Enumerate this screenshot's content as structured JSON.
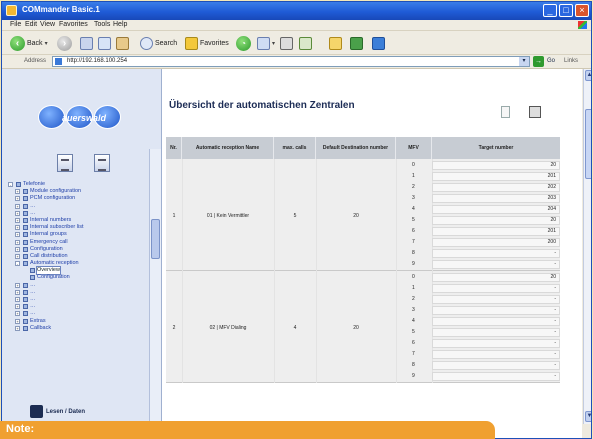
{
  "window": {
    "title": "COMmander Basic.1"
  },
  "menu": [
    "File",
    "Edit",
    "View",
    "Favorites",
    "Tools",
    "Help"
  ],
  "toolbar": {
    "back_label": "Back",
    "search_label": "Search",
    "favorites_label": "Favorites"
  },
  "address": {
    "label": "Address",
    "url": "http://192.168.100.254",
    "go_label": "Go",
    "links_label": "Links"
  },
  "logo_text": "auerswald",
  "tree": [
    {
      "label": "Telefonie",
      "level": 0,
      "expander": "-",
      "top": true
    },
    {
      "label": "Module configuration",
      "level": 1,
      "expander": "+"
    },
    {
      "label": "PCM configuration",
      "level": 1,
      "expander": "+"
    },
    {
      "label": "…",
      "level": 1,
      "expander": "+"
    },
    {
      "label": "…",
      "level": 1,
      "expander": "+"
    },
    {
      "label": "Internal numbers",
      "level": 1,
      "expander": "+"
    },
    {
      "label": "Internal subscriber list",
      "level": 1,
      "expander": "+"
    },
    {
      "label": "Internal groups",
      "level": 1,
      "expander": "+"
    },
    {
      "label": "Emergency call",
      "level": 1,
      "expander": "+"
    },
    {
      "label": "Configuration",
      "level": 1,
      "expander": "+"
    },
    {
      "label": "Call distribution",
      "level": 1,
      "expander": "+"
    },
    {
      "label": "Automatic reception",
      "level": 1,
      "expander": "-"
    },
    {
      "label": "Overview",
      "level": 2,
      "expander": "",
      "selected": true
    },
    {
      "label": "Configuration",
      "level": 2,
      "expander": ""
    },
    {
      "label": "…",
      "level": 1,
      "expander": "+"
    },
    {
      "label": "…",
      "level": 1,
      "expander": "+"
    },
    {
      "label": "…",
      "level": 1,
      "expander": "+"
    },
    {
      "label": "…",
      "level": 1,
      "expander": "+"
    },
    {
      "label": "…",
      "level": 1,
      "expander": "+"
    },
    {
      "label": "Extras",
      "level": 1,
      "expander": "+"
    },
    {
      "label": "Callback",
      "level": 1,
      "expander": "+"
    }
  ],
  "footer_brand": "Lesen / Daten",
  "page": {
    "title": "Übersicht der automatischen Zentralen"
  },
  "table": {
    "headers": [
      "Nr.",
      "Automatic reception Name",
      "max. calls",
      "Default Destination number",
      "MFV",
      "Target number"
    ],
    "groups": [
      {
        "nr": "1",
        "name": "01 | Kein Vermittler",
        "max_calls": "5",
        "default_dest": "20",
        "subrows": [
          {
            "mfv": "0",
            "target": "20"
          },
          {
            "mfv": "1",
            "target": "201"
          },
          {
            "mfv": "2",
            "target": "202"
          },
          {
            "mfv": "3",
            "target": "203"
          },
          {
            "mfv": "4",
            "target": "204"
          },
          {
            "mfv": "5",
            "target": "20"
          },
          {
            "mfv": "6",
            "target": "201"
          },
          {
            "mfv": "7",
            "target": "200"
          },
          {
            "mfv": "8",
            "target": "-"
          },
          {
            "mfv": "9",
            "target": "-"
          }
        ]
      },
      {
        "nr": "2",
        "name": "02 | MFV Dialing",
        "max_calls": "4",
        "default_dest": "20",
        "subrows": [
          {
            "mfv": "0",
            "target": "20"
          },
          {
            "mfv": "1",
            "target": "-"
          },
          {
            "mfv": "2",
            "target": "-"
          },
          {
            "mfv": "3",
            "target": "-"
          },
          {
            "mfv": "4",
            "target": "-"
          },
          {
            "mfv": "5",
            "target": "-"
          },
          {
            "mfv": "6",
            "target": "-"
          },
          {
            "mfv": "7",
            "target": "-"
          },
          {
            "mfv": "8",
            "target": "-"
          },
          {
            "mfv": "9",
            "target": "-"
          }
        ]
      }
    ]
  },
  "note": {
    "label": "Note:"
  },
  "colors": {
    "titlebar": "#1f5bd6",
    "note_banner": "#f0a030",
    "table_header": "#c7ccd3",
    "tree_bg": "#dfe6f4"
  }
}
